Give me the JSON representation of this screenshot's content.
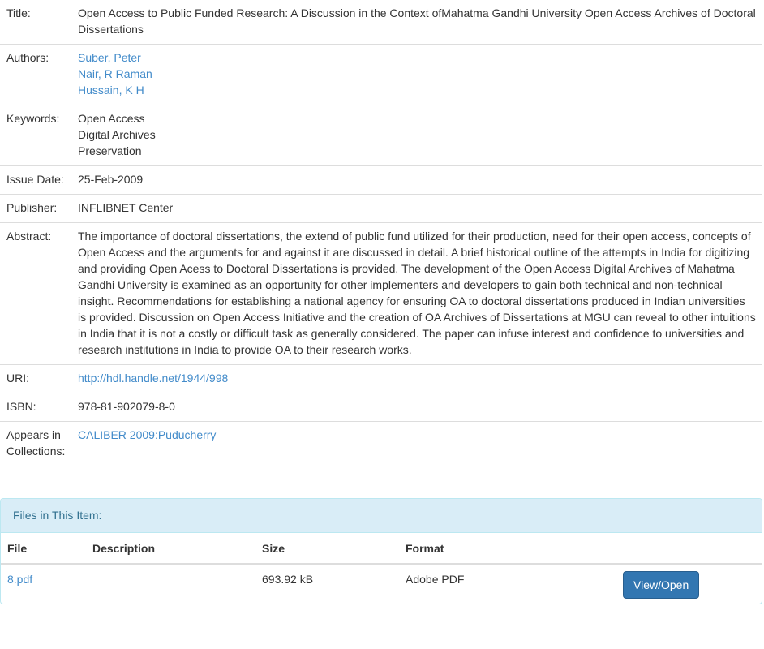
{
  "item": {
    "title_label": "Title:",
    "title": "Open Access to Public Funded Research: A Discussion in the Context ofMahatma Gandhi University Open Access Archives of Doctoral Dissertations",
    "authors_label": "Authors:",
    "authors": [
      "Suber, Peter",
      "Nair, R Raman",
      "Hussain, K H"
    ],
    "keywords_label": "Keywords:",
    "keywords": [
      "Open Access",
      "Digital Archives",
      "Preservation"
    ],
    "issue_date_label": "Issue Date:",
    "issue_date": "25-Feb-2009",
    "publisher_label": "Publisher:",
    "publisher": "INFLIBNET Center",
    "abstract_label": "Abstract:",
    "abstract": "The importance of doctoral dissertations, the extend of public fund utilized for their production, need for their open access, concepts of Open Access and the arguments for and against it are discussed in detail. A brief historical outline of the attempts in India for digitizing and providing Open Acess to Doctoral Dissertations is provided. The development of the Open Access Digital Archives of Mahatma Gandhi University is examined as an opportunity for other implementers and developers to gain both technical and non-technical insight. Recommendations for establishing a national agency for ensuring OA to doctoral dissertations produced in Indian universities is provided. Discussion on Open Access Initiative and the creation of OA Archives of Dissertations at MGU can reveal to other intuitions in India that it is not a costly or difficult task as generally considered. The paper can infuse interest and confidence to universities and research institutions in India to provide OA to their research works.",
    "uri_label": "URI:",
    "uri": "http://hdl.handle.net/1944/998",
    "isbn_label": "ISBN:",
    "isbn": "978-81-902079-8-0",
    "collections_label": "Appears in Collections:",
    "collection": "CALIBER 2009:Puducherry"
  },
  "files": {
    "heading": "Files in This Item:",
    "columns": {
      "file": "File",
      "description": "Description",
      "size": "Size",
      "format": "Format"
    },
    "rows": [
      {
        "file": "8.pdf",
        "description": "",
        "size": "693.92 kB",
        "format": "Adobe PDF",
        "action": "View/Open"
      }
    ]
  },
  "colors": {
    "link": "#428bca",
    "panel_heading_bg": "#d9edf7",
    "panel_heading_text": "#31708f",
    "panel_border": "#bce8f1",
    "button_bg": "#3276b1"
  }
}
